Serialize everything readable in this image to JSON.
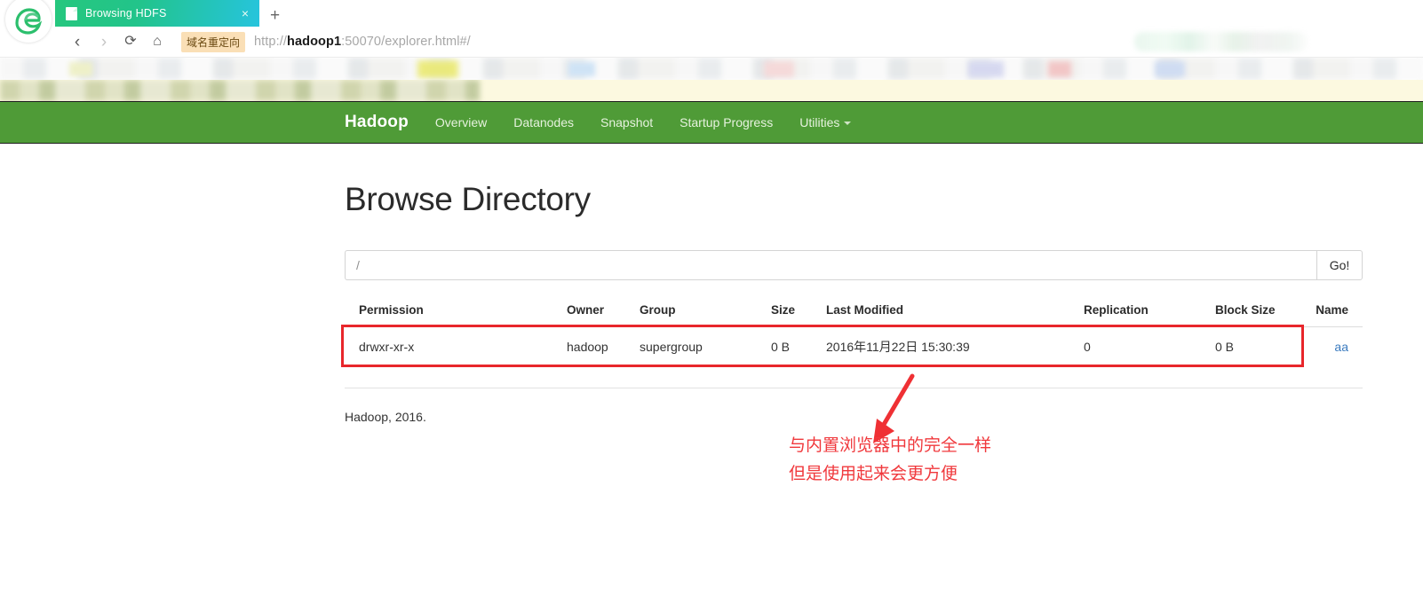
{
  "browser": {
    "logo_icon": "edge-browser-logo",
    "tab": {
      "title": "Browsing HDFS",
      "favicon_icon": "page-icon",
      "close_icon": "×"
    },
    "new_tab_label": "+",
    "nav": {
      "back_icon": "‹",
      "forward_icon": "›",
      "reload_icon": "⟳",
      "home_icon": "⌂"
    },
    "redirect_badge": "域名重定向",
    "url": {
      "scheme": "http://",
      "host": "hadoop1",
      "rest": ":50070/explorer.html#/"
    }
  },
  "hadoop_nav": {
    "brand": "Hadoop",
    "links": [
      {
        "label": "Overview",
        "has_caret": false
      },
      {
        "label": "Datanodes",
        "has_caret": false
      },
      {
        "label": "Snapshot",
        "has_caret": false
      },
      {
        "label": "Startup Progress",
        "has_caret": false
      },
      {
        "label": "Utilities",
        "has_caret": true
      }
    ],
    "bg_color": "#4f9b37"
  },
  "main": {
    "title": "Browse Directory",
    "path_input_value": "/",
    "path_input_placeholder": "/",
    "go_button": "Go!",
    "table": {
      "headers": [
        "Permission",
        "Owner",
        "Group",
        "Size",
        "Last Modified",
        "Replication",
        "Block Size",
        "Name"
      ],
      "rows": [
        {
          "permission": "drwxr-xr-x",
          "owner": "hadoop",
          "group": "supergroup",
          "size": "0 B",
          "last_modified": "2016年11月22日 15:30:39",
          "replication": "0",
          "block_size": "0 B",
          "name": "aa"
        }
      ]
    },
    "footer": "Hadoop, 2016."
  },
  "annotation": {
    "line1": "与内置浏览器中的完全一样",
    "line2": "但是使用起来会更方便",
    "color": "#f0383c",
    "highlight_box_color": "#e8262b",
    "arrow_icon": "down-left-arrow-icon"
  }
}
